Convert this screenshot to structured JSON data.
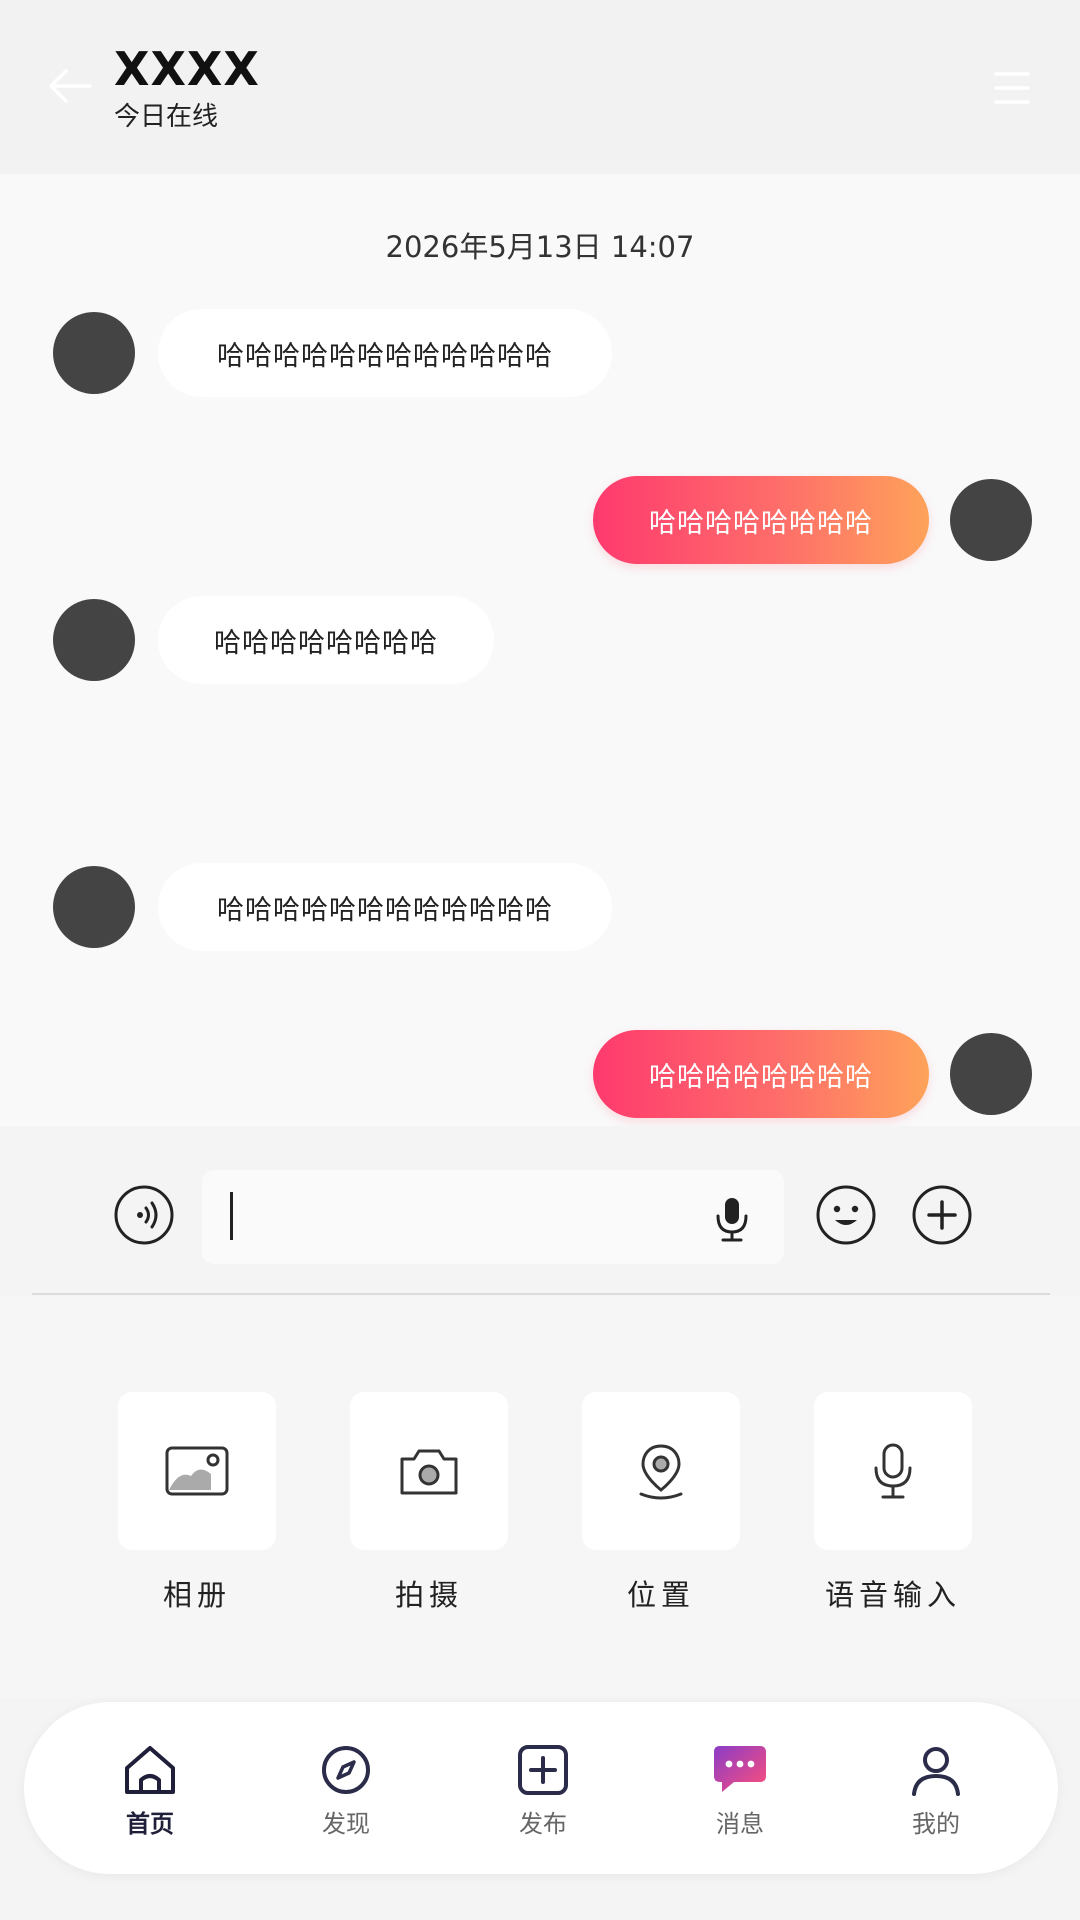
{
  "header": {
    "title": "XXXX",
    "status": "今日在线"
  },
  "chat": {
    "timestamp": "2026年5月13日 14:07",
    "messages": [
      {
        "side": "in",
        "text": "哈哈哈哈哈哈哈哈哈哈哈哈"
      },
      {
        "side": "out",
        "text": "哈哈哈哈哈哈哈哈"
      },
      {
        "side": "in",
        "text": "哈哈哈哈哈哈哈哈"
      },
      {
        "side": "in",
        "text": "哈哈哈哈哈哈哈哈哈哈哈哈"
      },
      {
        "side": "out",
        "text": "哈哈哈哈哈哈哈哈"
      }
    ]
  },
  "input": {
    "value": "",
    "icons": [
      "voice-toggle-icon",
      "microphone-icon",
      "emoji-icon",
      "plus-icon"
    ]
  },
  "tools": [
    {
      "label": "相册",
      "icon": "album-icon"
    },
    {
      "label": "拍摄",
      "icon": "camera-icon"
    },
    {
      "label": "位置",
      "icon": "location-icon"
    },
    {
      "label": "语音输入",
      "icon": "microphone-icon"
    }
  ],
  "nav": {
    "items": [
      {
        "label": "首页",
        "icon": "home-icon"
      },
      {
        "label": "发现",
        "icon": "compass-icon"
      },
      {
        "label": "发布",
        "icon": "add-square-icon"
      },
      {
        "label": "消息",
        "icon": "chat-bubble-icon"
      },
      {
        "label": "我的",
        "icon": "user-icon"
      }
    ],
    "active": "首页"
  },
  "colors": {
    "outgoing_gradient_start": "#fe3a6e",
    "outgoing_gradient_end": "#fea35a",
    "nav_active": "#1f1f3a",
    "message_icon_gradient_start": "#8a3cc7",
    "message_icon_gradient_end": "#ff4f7a"
  }
}
